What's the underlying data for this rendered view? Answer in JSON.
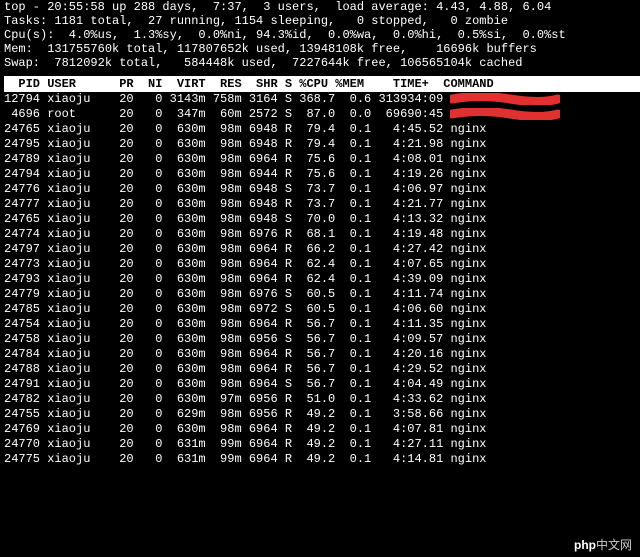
{
  "summary": {
    "line1": "top - 20:55:58 up 288 days,  7:37,  3 users,  load average: 4.43, 4.88, 6.04",
    "line2": "Tasks: 1181 total,  27 running, 1154 sleeping,   0 stopped,   0 zombie",
    "line3": "Cpu(s):  4.0%us,  1.3%sy,  0.0%ni, 94.3%id,  0.0%wa,  0.0%hi,  0.5%si,  0.0%st",
    "line4": "Mem:  131755760k total, 117807652k used, 13948108k free,    16696k buffers",
    "line5": "Swap:  7812092k total,   584448k used,  7227644k free, 106565104k cached"
  },
  "columns": "  PID USER      PR  NI  VIRT  RES  SHR S %CPU %MEM    TIME+  COMMAND",
  "processes": [
    {
      "pid": "12794",
      "user": "xiaoju",
      "pr": "20",
      "ni": "0",
      "virt": "3143m",
      "res": "758m",
      "shr": "3164",
      "s": "S",
      "cpu": "368.7",
      "mem": "0.6",
      "time": "313934:09",
      "cmd": "",
      "redacted": true
    },
    {
      "pid": "4696",
      "user": "root",
      "pr": "20",
      "ni": "0",
      "virt": "347m",
      "res": "60m",
      "shr": "2572",
      "s": "S",
      "cpu": "87.0",
      "mem": "0.0",
      "time": "69690:45",
      "cmd": "",
      "redacted": true
    },
    {
      "pid": "24765",
      "user": "xiaoju",
      "pr": "20",
      "ni": "0",
      "virt": "630m",
      "res": "98m",
      "shr": "6948",
      "s": "R",
      "cpu": "79.4",
      "mem": "0.1",
      "time": "4:45.52",
      "cmd": "nginx"
    },
    {
      "pid": "24795",
      "user": "xiaoju",
      "pr": "20",
      "ni": "0",
      "virt": "630m",
      "res": "98m",
      "shr": "6948",
      "s": "R",
      "cpu": "79.4",
      "mem": "0.1",
      "time": "4:21.98",
      "cmd": "nginx"
    },
    {
      "pid": "24789",
      "user": "xiaoju",
      "pr": "20",
      "ni": "0",
      "virt": "630m",
      "res": "98m",
      "shr": "6964",
      "s": "R",
      "cpu": "75.6",
      "mem": "0.1",
      "time": "4:08.01",
      "cmd": "nginx"
    },
    {
      "pid": "24794",
      "user": "xiaoju",
      "pr": "20",
      "ni": "0",
      "virt": "630m",
      "res": "98m",
      "shr": "6944",
      "s": "R",
      "cpu": "75.6",
      "mem": "0.1",
      "time": "4:19.26",
      "cmd": "nginx"
    },
    {
      "pid": "24776",
      "user": "xiaoju",
      "pr": "20",
      "ni": "0",
      "virt": "630m",
      "res": "98m",
      "shr": "6948",
      "s": "S",
      "cpu": "73.7",
      "mem": "0.1",
      "time": "4:06.97",
      "cmd": "nginx"
    },
    {
      "pid": "24777",
      "user": "xiaoju",
      "pr": "20",
      "ni": "0",
      "virt": "630m",
      "res": "98m",
      "shr": "6948",
      "s": "R",
      "cpu": "73.7",
      "mem": "0.1",
      "time": "4:21.77",
      "cmd": "nginx"
    },
    {
      "pid": "24765",
      "user": "xiaoju",
      "pr": "20",
      "ni": "0",
      "virt": "630m",
      "res": "98m",
      "shr": "6948",
      "s": "S",
      "cpu": "70.0",
      "mem": "0.1",
      "time": "4:13.32",
      "cmd": "nginx"
    },
    {
      "pid": "24774",
      "user": "xiaoju",
      "pr": "20",
      "ni": "0",
      "virt": "630m",
      "res": "98m",
      "shr": "6976",
      "s": "R",
      "cpu": "68.1",
      "mem": "0.1",
      "time": "4:19.48",
      "cmd": "nginx"
    },
    {
      "pid": "24797",
      "user": "xiaoju",
      "pr": "20",
      "ni": "0",
      "virt": "630m",
      "res": "98m",
      "shr": "6964",
      "s": "R",
      "cpu": "66.2",
      "mem": "0.1",
      "time": "4:27.42",
      "cmd": "nginx"
    },
    {
      "pid": "24773",
      "user": "xiaoju",
      "pr": "20",
      "ni": "0",
      "virt": "630m",
      "res": "98m",
      "shr": "6964",
      "s": "R",
      "cpu": "62.4",
      "mem": "0.1",
      "time": "4:07.65",
      "cmd": "nginx"
    },
    {
      "pid": "24793",
      "user": "xiaoju",
      "pr": "20",
      "ni": "0",
      "virt": "630m",
      "res": "98m",
      "shr": "6964",
      "s": "R",
      "cpu": "62.4",
      "mem": "0.1",
      "time": "4:39.09",
      "cmd": "nginx"
    },
    {
      "pid": "24779",
      "user": "xiaoju",
      "pr": "20",
      "ni": "0",
      "virt": "630m",
      "res": "98m",
      "shr": "6976",
      "s": "S",
      "cpu": "60.5",
      "mem": "0.1",
      "time": "4:11.74",
      "cmd": "nginx"
    },
    {
      "pid": "24785",
      "user": "xiaoju",
      "pr": "20",
      "ni": "0",
      "virt": "630m",
      "res": "98m",
      "shr": "6972",
      "s": "S",
      "cpu": "60.5",
      "mem": "0.1",
      "time": "4:06.60",
      "cmd": "nginx"
    },
    {
      "pid": "24754",
      "user": "xiaoju",
      "pr": "20",
      "ni": "0",
      "virt": "630m",
      "res": "98m",
      "shr": "6964",
      "s": "R",
      "cpu": "56.7",
      "mem": "0.1",
      "time": "4:11.35",
      "cmd": "nginx"
    },
    {
      "pid": "24758",
      "user": "xiaoju",
      "pr": "20",
      "ni": "0",
      "virt": "630m",
      "res": "98m",
      "shr": "6956",
      "s": "S",
      "cpu": "56.7",
      "mem": "0.1",
      "time": "4:09.57",
      "cmd": "nginx"
    },
    {
      "pid": "24784",
      "user": "xiaoju",
      "pr": "20",
      "ni": "0",
      "virt": "630m",
      "res": "98m",
      "shr": "6964",
      "s": "R",
      "cpu": "56.7",
      "mem": "0.1",
      "time": "4:20.16",
      "cmd": "nginx"
    },
    {
      "pid": "24788",
      "user": "xiaoju",
      "pr": "20",
      "ni": "0",
      "virt": "630m",
      "res": "98m",
      "shr": "6964",
      "s": "R",
      "cpu": "56.7",
      "mem": "0.1",
      "time": "4:29.52",
      "cmd": "nginx"
    },
    {
      "pid": "24791",
      "user": "xiaoju",
      "pr": "20",
      "ni": "0",
      "virt": "630m",
      "res": "98m",
      "shr": "6964",
      "s": "S",
      "cpu": "56.7",
      "mem": "0.1",
      "time": "4:04.49",
      "cmd": "nginx"
    },
    {
      "pid": "24782",
      "user": "xiaoju",
      "pr": "20",
      "ni": "0",
      "virt": "630m",
      "res": "97m",
      "shr": "6956",
      "s": "R",
      "cpu": "51.0",
      "mem": "0.1",
      "time": "4:33.62",
      "cmd": "nginx"
    },
    {
      "pid": "24755",
      "user": "xiaoju",
      "pr": "20",
      "ni": "0",
      "virt": "629m",
      "res": "98m",
      "shr": "6956",
      "s": "R",
      "cpu": "49.2",
      "mem": "0.1",
      "time": "3:58.66",
      "cmd": "nginx"
    },
    {
      "pid": "24769",
      "user": "xiaoju",
      "pr": "20",
      "ni": "0",
      "virt": "630m",
      "res": "98m",
      "shr": "6964",
      "s": "R",
      "cpu": "49.2",
      "mem": "0.1",
      "time": "4:07.81",
      "cmd": "nginx"
    },
    {
      "pid": "24770",
      "user": "xiaoju",
      "pr": "20",
      "ni": "0",
      "virt": "631m",
      "res": "99m",
      "shr": "6964",
      "s": "R",
      "cpu": "49.2",
      "mem": "0.1",
      "time": "4:27.11",
      "cmd": "nginx"
    },
    {
      "pid": "24775",
      "user": "xiaoju",
      "pr": "20",
      "ni": "0",
      "virt": "631m",
      "res": "99m",
      "shr": "6964",
      "s": "R",
      "cpu": "49.2",
      "mem": "0.1",
      "time": "4:14.81",
      "cmd": "nginx"
    }
  ],
  "watermark": {
    "brand": "php",
    "text": "中文网"
  }
}
